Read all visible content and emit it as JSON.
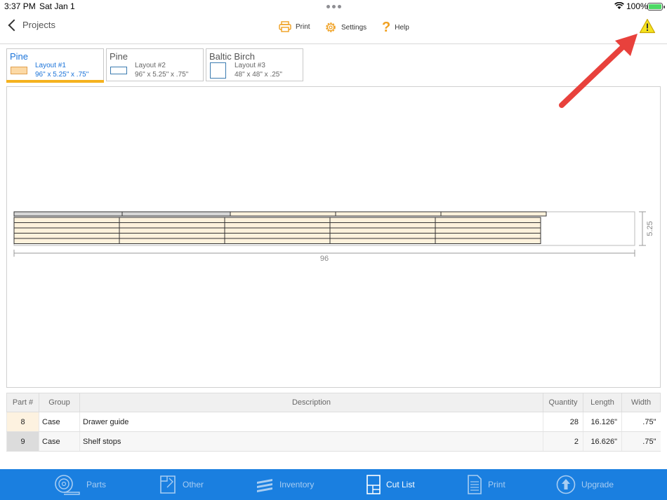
{
  "status": {
    "time": "3:37 PM",
    "date": "Sat Jan 1",
    "battery": "100%"
  },
  "nav": {
    "back_label": "Projects",
    "print_label": "Print",
    "settings_label": "Settings",
    "help_label": "Help"
  },
  "layouts": [
    {
      "wood": "Pine",
      "name": "Layout #1",
      "dims": "96\" x 5.25\" x .75\"",
      "active": true
    },
    {
      "wood": "Pine",
      "name": "Layout #2",
      "dims": "96\" x 5.25\" x .75\"",
      "active": false
    },
    {
      "wood": "Baltic Birch",
      "name": "Layout #3",
      "dims": "48\" x 48\" x .25\"",
      "active": false
    }
  ],
  "diagram": {
    "width_label": "96",
    "height_label": "5.25"
  },
  "table": {
    "headers": [
      "Part #",
      "Group",
      "Description",
      "Quantity",
      "Length",
      "Width"
    ],
    "rows": [
      {
        "part": "8",
        "group": "Case",
        "description": "Drawer guide",
        "quantity": "28",
        "length": "16.126\"",
        "width": ".75\""
      },
      {
        "part": "9",
        "group": "Case",
        "description": "Shelf stops",
        "quantity": "2",
        "length": "16.626\"",
        "width": ".75\""
      }
    ]
  },
  "bottom_tabs": [
    {
      "label": "Parts",
      "icon": "tape-measure-icon",
      "active": false
    },
    {
      "label": "Other",
      "icon": "other-parts-icon",
      "active": false
    },
    {
      "label": "Inventory",
      "icon": "stack-icon",
      "active": false
    },
    {
      "label": "Cut List",
      "icon": "cut-list-icon",
      "active": true
    },
    {
      "label": "Print",
      "icon": "document-icon",
      "active": false
    },
    {
      "label": "Upgrade",
      "icon": "upgrade-arrow-icon",
      "active": false
    }
  ],
  "colors": {
    "accent": "#1a7fe0",
    "active_tab_underline": "#f5b21e",
    "part_fill": "#fdf2dc",
    "warning": "#f5e21e",
    "annotation_arrow": "#e8413c"
  }
}
